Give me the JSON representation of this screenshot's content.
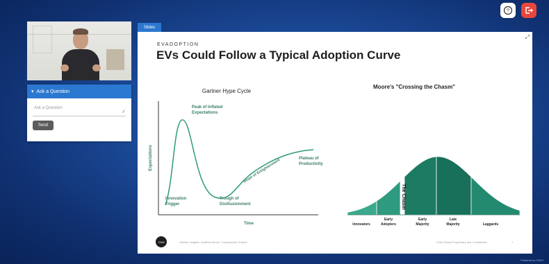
{
  "toolbar": {
    "help_icon": "?",
    "exit_icon": "exit"
  },
  "qa": {
    "header": "Ask a Question",
    "placeholder": "Ask a Question",
    "send_label": "Send"
  },
  "slides_tab": {
    "label": "Slides"
  },
  "slide": {
    "kicker": "EVADOPTION",
    "title": "EVs Could Follow a Typical Adoption Curve",
    "logo_text": "CDM",
    "footer_source": "Gartner Insights; Geoffrey Moore \"Crossing the Chasm\"",
    "footer_conf": "CDM Global Proprietary and Confidential"
  },
  "hype_cycle": {
    "title": "Gartner Hype Cycle",
    "ylabel": "Expectations",
    "xlabel": "Time",
    "labels": {
      "peak_line1": "Peak of Inflated",
      "peak_line2": "Expectations",
      "trigger_line1": "Innovation",
      "trigger_line2": "Trigger",
      "trough_line1": "Trough of",
      "trough_line2": "Disillusionment",
      "slope": "Slope of Enlightenment",
      "plateau_line1": "Plateau of",
      "plateau_line2": "Productivity"
    }
  },
  "chasm": {
    "title": "Moore's \"Crossing the Chasm\"",
    "chasm_label": "The Chasm",
    "segments": [
      {
        "line1": "",
        "line2": "Innovators",
        "color": "#3aa98c"
      },
      {
        "line1": "Early",
        "line2": "Adopters",
        "color": "#2e9a7f"
      },
      {
        "line1": "Early",
        "line2": "Majority",
        "color": "#1d7a63"
      },
      {
        "line1": "Late",
        "line2": "Majority",
        "color": "#18705a"
      },
      {
        "line1": "",
        "line2": "Laggards",
        "color": "#238a70"
      }
    ]
  },
  "powered_by": "Powered by ON24"
}
